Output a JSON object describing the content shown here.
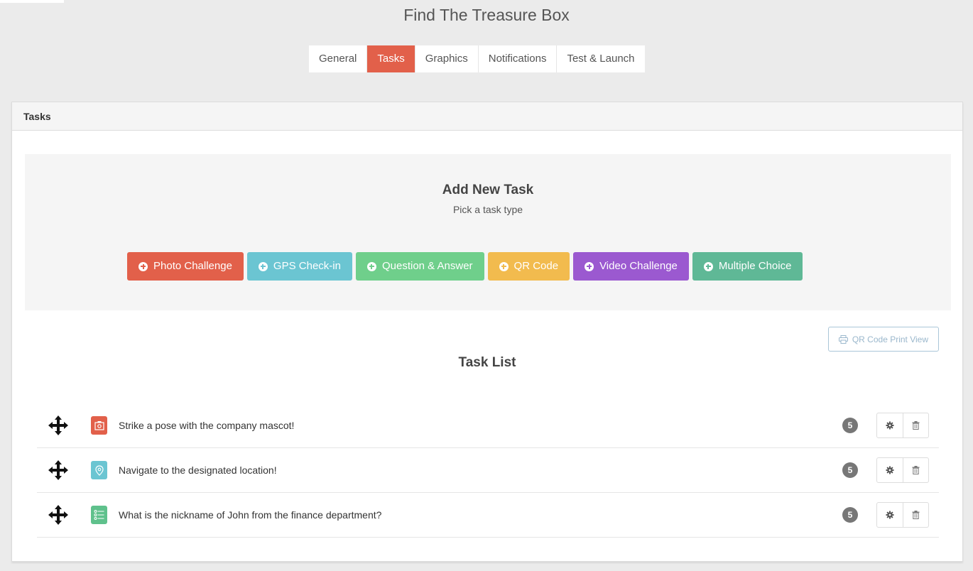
{
  "header": {
    "title": "Find The Treasure Box"
  },
  "tabs": [
    {
      "label": "General",
      "active": false
    },
    {
      "label": "Tasks",
      "active": true
    },
    {
      "label": "Graphics",
      "active": false
    },
    {
      "label": "Notifications",
      "active": false
    },
    {
      "label": "Test & Launch",
      "active": false
    }
  ],
  "panel": {
    "title": "Tasks"
  },
  "add_task": {
    "title": "Add New Task",
    "subtitle": "Pick a task type",
    "types": [
      {
        "label": "Photo Challenge",
        "color": "#e2604a"
      },
      {
        "label": "GPS Check-in",
        "color": "#6bc5d2"
      },
      {
        "label": "Question & Answer",
        "color": "#6fcf8b"
      },
      {
        "label": "QR Code",
        "color": "#f2bb4e"
      },
      {
        "label": "Video Challenge",
        "color": "#9b59d0"
      },
      {
        "label": "Multiple Choice",
        "color": "#5fb896"
      }
    ]
  },
  "print_view": {
    "label": "QR Code Print View"
  },
  "task_list": {
    "title": "Task List",
    "tasks": [
      {
        "text": "Strike a pose with the company mascot!",
        "points": "5",
        "icon": "photo-icon",
        "color": "#e2604a"
      },
      {
        "text": "Navigate to the designated location!",
        "points": "5",
        "icon": "location-pin-icon",
        "color": "#6bc5d2"
      },
      {
        "text": "What is the nickname of John from the finance department?",
        "points": "5",
        "icon": "list-icon",
        "color": "#5fc18c"
      }
    ]
  }
}
